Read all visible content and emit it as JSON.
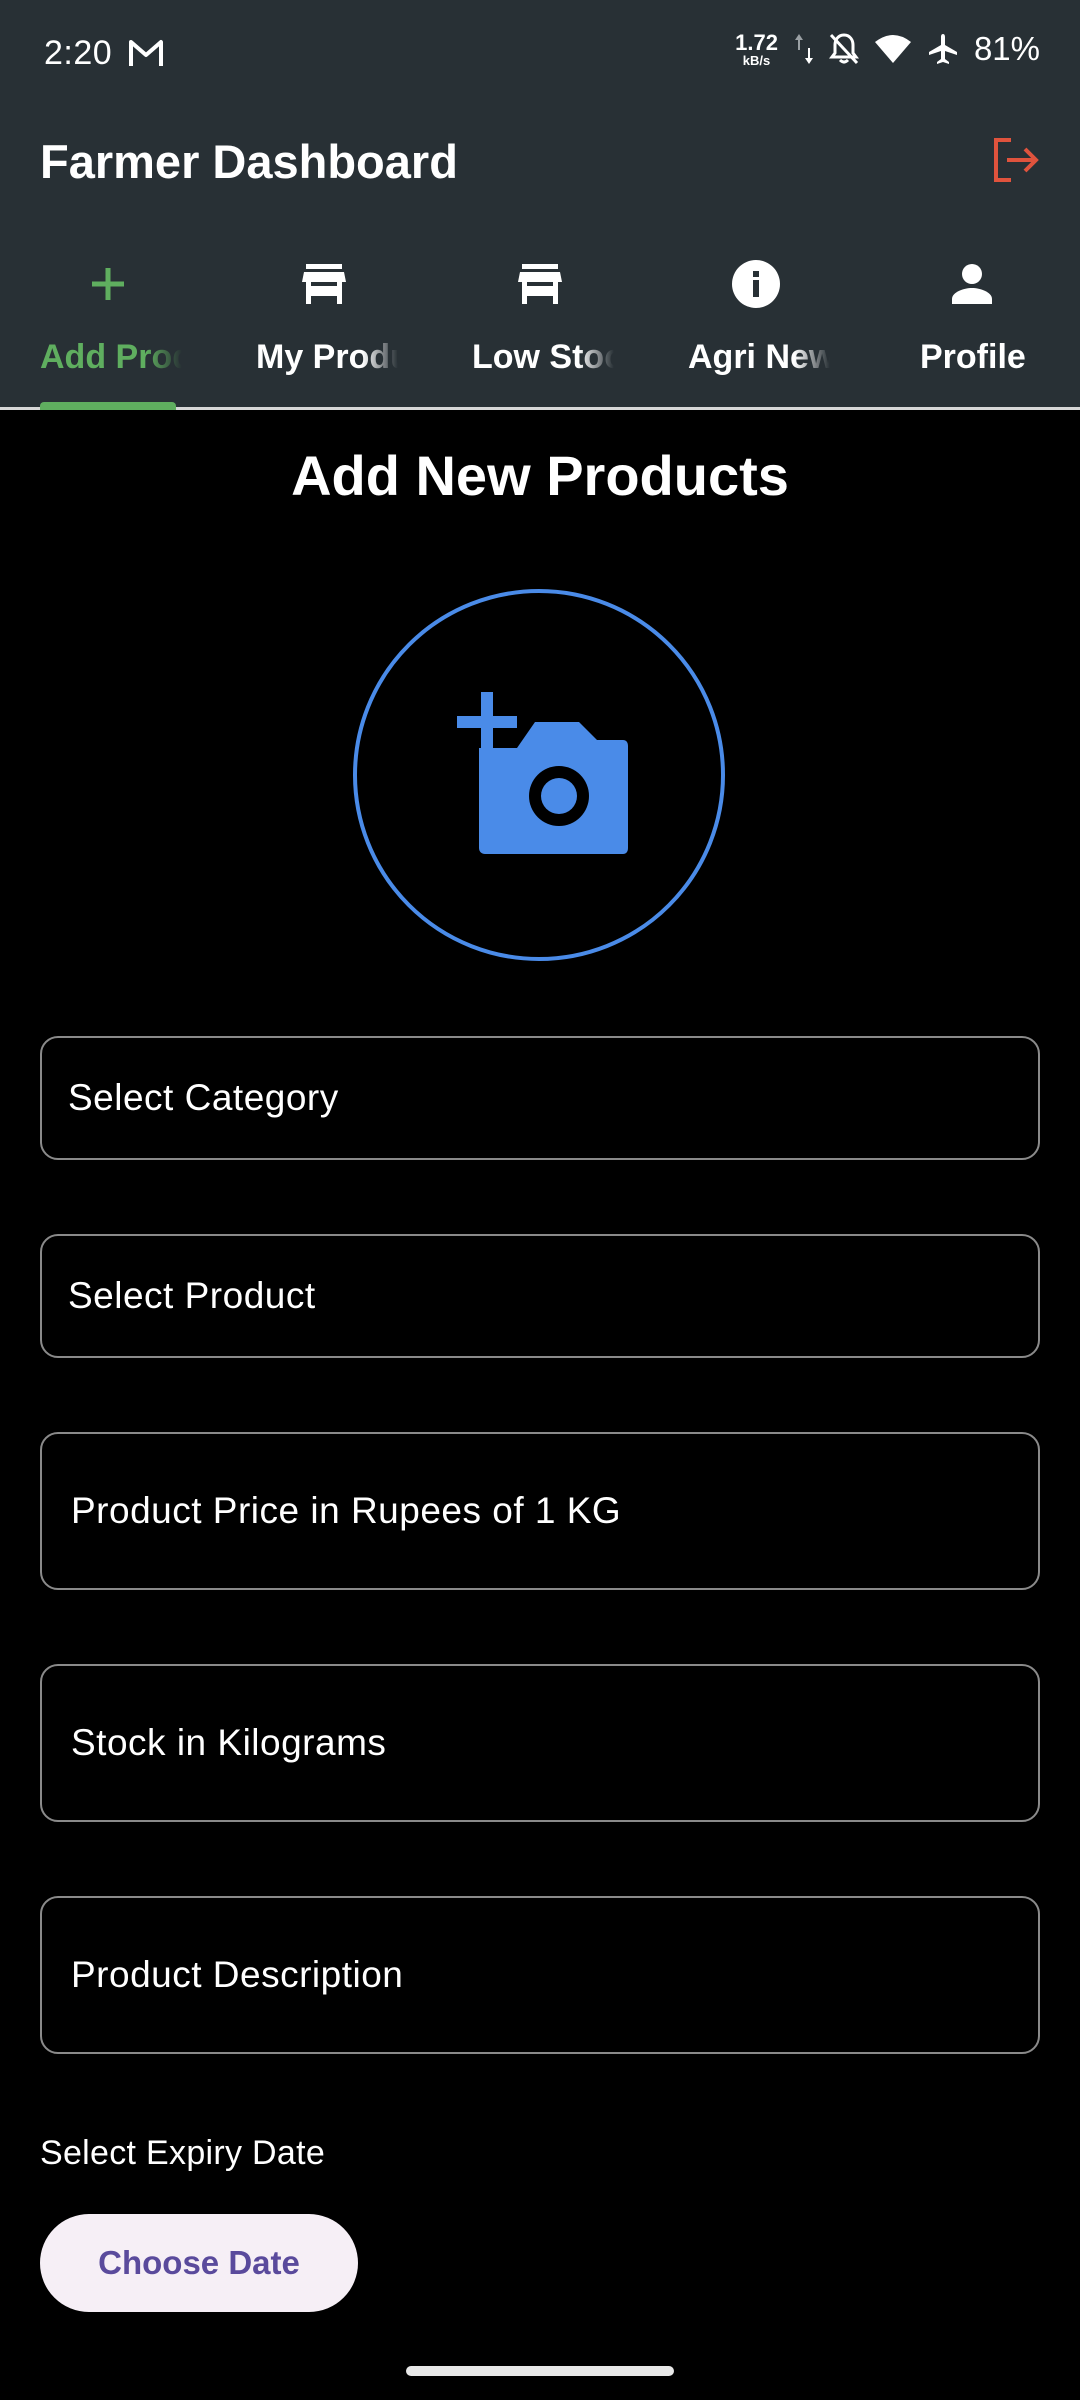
{
  "status_bar": {
    "time": "2:20",
    "net_speed_value": "1.72",
    "net_speed_unit": "kB/s",
    "battery": "81%"
  },
  "app_bar": {
    "title": "Farmer Dashboard"
  },
  "tabs": [
    {
      "label": "Add Products",
      "icon": "plus-icon",
      "active": true
    },
    {
      "label": "My Products",
      "icon": "store-icon",
      "active": false
    },
    {
      "label": "Low Stock",
      "icon": "store-icon",
      "active": false
    },
    {
      "label": "Agri News",
      "icon": "info-icon",
      "active": false
    },
    {
      "label": "Profile",
      "icon": "person-icon",
      "active": false
    }
  ],
  "form": {
    "title": "Add New Products",
    "category_placeholder": "Select Category",
    "product_placeholder": "Select Product",
    "price_placeholder": "Product Price in Rupees of 1 KG",
    "stock_placeholder": "Stock in Kilograms",
    "description_placeholder": "Product Description",
    "expiry_label": "Select Expiry Date",
    "choose_date_label": "Choose Date"
  },
  "colors": {
    "app_bar_bg": "#283035",
    "accent_green": "#5fae5f",
    "accent_blue": "#4a8be8",
    "logout_red": "#e0533d",
    "button_bg": "#f6eff6",
    "button_text": "#5a4a9c"
  }
}
